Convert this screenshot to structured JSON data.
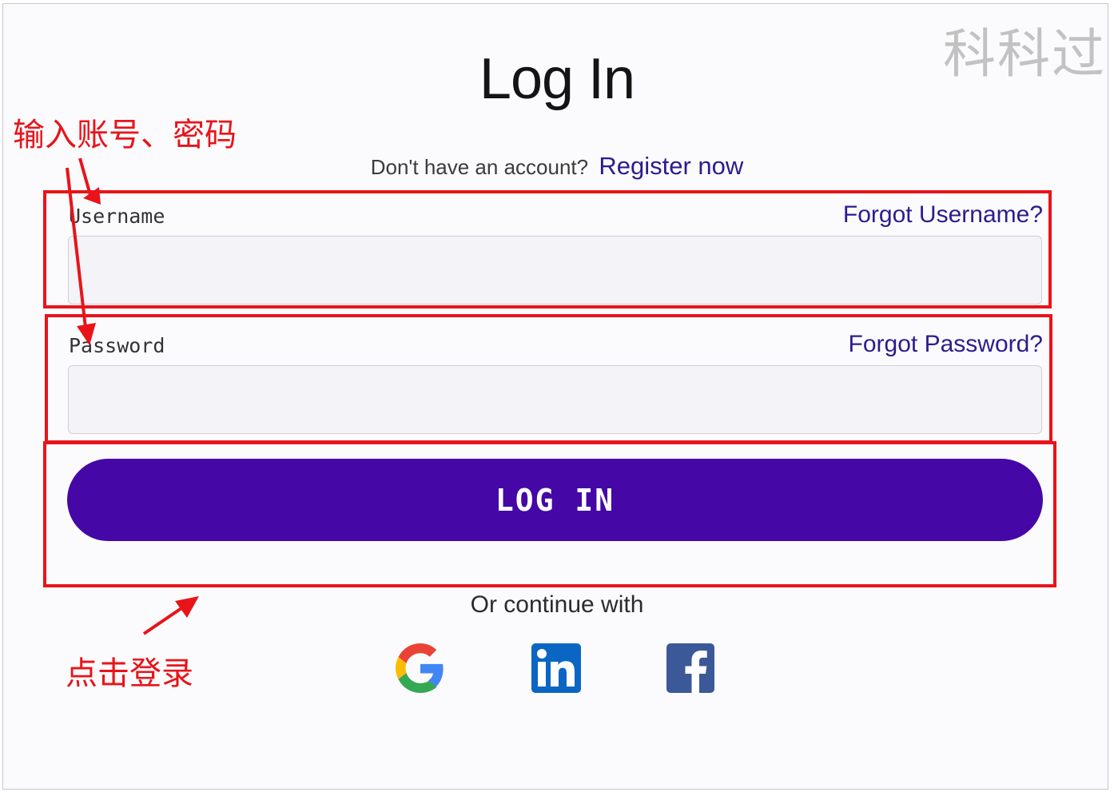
{
  "watermark": "科科过",
  "page": {
    "title": "Log In",
    "register_prompt": "Don't have an account?",
    "register_link": "Register now"
  },
  "form": {
    "username_label": "Username",
    "forgot_username": "Forgot Username?",
    "username_value": "",
    "password_label": "Password",
    "forgot_password": "Forgot Password?",
    "password_value": "",
    "login_button": "LOG IN"
  },
  "social": {
    "label": "Or continue with",
    "providers": [
      "google-icon",
      "linkedin-icon",
      "facebook-icon"
    ]
  },
  "annotations": {
    "enter_credentials": "输入账号、密码",
    "click_login": "点击登录",
    "color": "#e8141a"
  },
  "colors": {
    "primary": "#4507a6",
    "link": "#2c1c8e",
    "annotation": "#e8141a"
  }
}
